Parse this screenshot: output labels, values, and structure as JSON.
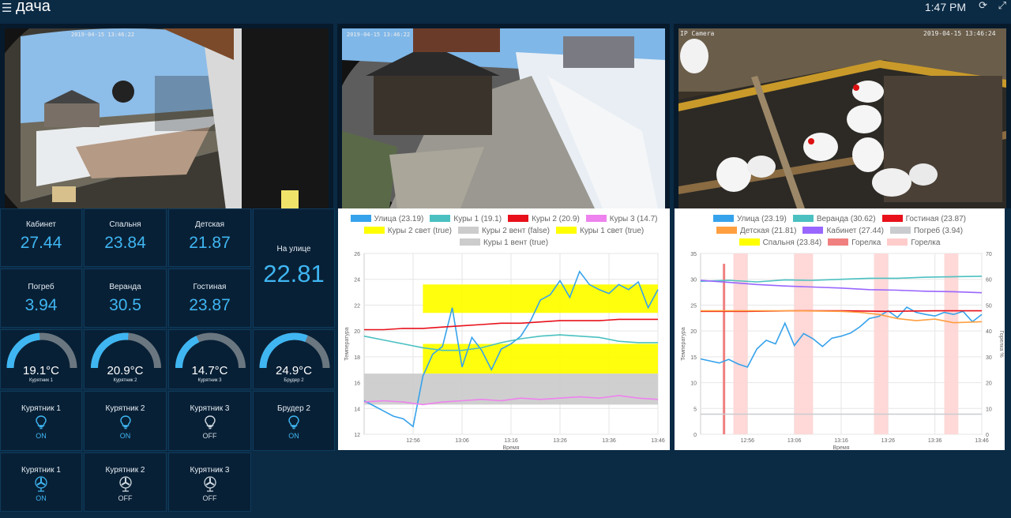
{
  "header": {
    "title": "дача",
    "time": "1:47 PM"
  },
  "cameras": [
    {
      "stamp": "2019-04-15 13:46:22",
      "label": ""
    },
    {
      "stamp": "2019-04-15 13:46:22",
      "label": ""
    },
    {
      "stamp": "2019-04-15 13:46:24",
      "label": "IP Camera"
    }
  ],
  "sensors": [
    {
      "label": "Кабинет",
      "value": "27.44"
    },
    {
      "label": "Спальня",
      "value": "23.84"
    },
    {
      "label": "Детская",
      "value": "21.87"
    },
    {
      "label": "Погреб",
      "value": "3.94"
    },
    {
      "label": "Веранда",
      "value": "30.5"
    },
    {
      "label": "Гостиная",
      "value": "23.87"
    }
  ],
  "outside": {
    "label": "На улице",
    "value": "22.81"
  },
  "gauges": [
    {
      "value": "19.1°C",
      "label": "Курятник 1",
      "level": 19.1,
      "max": 40
    },
    {
      "value": "20.9°C",
      "label": "Курятник 2",
      "level": 20.9,
      "max": 40
    },
    {
      "value": "14.7°C",
      "label": "Курятник 3",
      "level": 14.7,
      "max": 40
    },
    {
      "value": "24.9°C",
      "label": "Брудер 2",
      "level": 24.9,
      "max": 40
    }
  ],
  "lights": [
    {
      "label": "Курятник 1",
      "state": "ON"
    },
    {
      "label": "Курятник 2",
      "state": "ON"
    },
    {
      "label": "Курятник 3",
      "state": "OFF"
    },
    {
      "label": "Брудер 2",
      "state": "ON"
    }
  ],
  "fans": [
    {
      "label": "Курятник 1",
      "state": "ON"
    },
    {
      "label": "Курятник 2",
      "state": "OFF"
    },
    {
      "label": "Курятник 3",
      "state": "OFF"
    }
  ],
  "colors": {
    "accent": "#3fb6f2",
    "bg": "#0b2a44",
    "tile": "#082036"
  },
  "icons": {
    "menu": "menu-icon",
    "refresh": "refresh-icon",
    "fullscreen": "fullscreen-icon",
    "light": "lightbulb-icon",
    "fan": "fan-icon"
  },
  "chart_data": [
    {
      "type": "line",
      "ylabel": "Температура",
      "xlabel": "Время",
      "ylim": [
        12,
        26
      ],
      "yticks": [
        12,
        14,
        16,
        18,
        20,
        22,
        24,
        26
      ],
      "xticks": [
        "12:56",
        "13:06",
        "13:16",
        "13:26",
        "13:36",
        "13:46"
      ],
      "grid": true,
      "legend": [
        {
          "name": "Улица (23.19)",
          "color": "#36a2eb"
        },
        {
          "name": "Куры 1 (19.1)",
          "color": "#4bc0c0"
        },
        {
          "name": "Куры 2 (20.9)",
          "color": "#e8101a"
        },
        {
          "name": "Куры 3 (14.7)",
          "color": "#ee82ee"
        },
        {
          "name": "Куры 2 свет (true)",
          "color": "#ffff00"
        },
        {
          "name": "Куры 2 вент (false)",
          "color": "#cccccc"
        },
        {
          "name": "Куры 1 свет (true)",
          "color": "#ffff00"
        },
        {
          "name": "Куры 1 вент (true)",
          "color": "#cccccc"
        }
      ],
      "bands": [
        {
          "name": "Куры 2 свет (true)",
          "from": "12:58",
          "to": "13:46",
          "ylow": 21.4,
          "yhigh": 23.6,
          "color": "#ffff00"
        },
        {
          "name": "Куры 1 свет (true)",
          "from": "12:58",
          "to": "13:46",
          "ylow": 16.7,
          "yhigh": 19.0,
          "color": "#ffff00"
        },
        {
          "name": "Куры 1 вент (true)",
          "from": "12:46",
          "to": "13:46",
          "ylow": 14.3,
          "yhigh": 16.7,
          "color": "#cccccc"
        }
      ],
      "series": [
        {
          "name": "Улица (23.19)",
          "color": "#36a2eb",
          "x": [
            "12:46",
            "12:48",
            "12:50",
            "12:52",
            "12:54",
            "12:56",
            "12:58",
            "13:00",
            "13:02",
            "13:04",
            "13:06",
            "13:08",
            "13:10",
            "13:12",
            "13:14",
            "13:16",
            "13:18",
            "13:20",
            "13:22",
            "13:24",
            "13:26",
            "13:28",
            "13:30",
            "13:32",
            "13:34",
            "13:36",
            "13:38",
            "13:40",
            "13:42",
            "13:44",
            "13:46"
          ],
          "y": [
            14.6,
            14.2,
            13.8,
            13.4,
            13.2,
            12.6,
            16.5,
            18.2,
            18.8,
            21.8,
            17.2,
            19.5,
            18.5,
            17.0,
            18.6,
            19.0,
            19.6,
            20.8,
            22.4,
            22.8,
            23.9,
            22.6,
            24.6,
            23.6,
            23.2,
            22.9,
            23.6,
            23.2,
            23.8,
            21.8,
            23.2
          ]
        },
        {
          "name": "Куры 1 (19.1)",
          "color": "#4bc0c0",
          "x": [
            "12:46",
            "12:50",
            "12:54",
            "12:58",
            "13:02",
            "13:06",
            "13:10",
            "13:14",
            "13:18",
            "13:22",
            "13:26",
            "13:30",
            "13:34",
            "13:38",
            "13:42",
            "13:46"
          ],
          "y": [
            19.6,
            19.3,
            19.0,
            18.7,
            18.5,
            18.5,
            18.7,
            19.1,
            19.4,
            19.6,
            19.7,
            19.6,
            19.5,
            19.2,
            19.1,
            19.1
          ]
        },
        {
          "name": "Куры 2 (20.9)",
          "color": "#e8101a",
          "x": [
            "12:46",
            "12:50",
            "12:54",
            "12:58",
            "13:02",
            "13:06",
            "13:10",
            "13:14",
            "13:18",
            "13:22",
            "13:26",
            "13:30",
            "13:34",
            "13:38",
            "13:42",
            "13:46"
          ],
          "y": [
            20.1,
            20.1,
            20.2,
            20.2,
            20.3,
            20.4,
            20.5,
            20.6,
            20.6,
            20.7,
            20.8,
            20.8,
            20.8,
            20.9,
            20.9,
            20.9
          ]
        },
        {
          "name": "Куры 3 (14.7)",
          "color": "#ee82ee",
          "x": [
            "12:46",
            "12:50",
            "12:54",
            "12:58",
            "13:02",
            "13:06",
            "13:10",
            "13:14",
            "13:18",
            "13:22",
            "13:26",
            "13:30",
            "13:34",
            "13:38",
            "13:42",
            "13:46"
          ],
          "y": [
            14.5,
            14.6,
            14.5,
            14.3,
            14.5,
            14.6,
            14.7,
            14.6,
            14.8,
            14.7,
            14.8,
            14.9,
            14.8,
            15.0,
            14.8,
            14.7
          ]
        }
      ]
    },
    {
      "type": "line",
      "ylabel": "Температура",
      "ylabel2": "Горелка %",
      "xlabel": "Время",
      "ylim": [
        0,
        35
      ],
      "ylim2": [
        0,
        70
      ],
      "yticks": [
        0,
        5,
        10,
        15,
        20,
        25,
        30,
        35
      ],
      "yticks2": [
        0,
        10,
        20,
        30,
        40,
        50,
        60,
        70
      ],
      "xticks": [
        "12:56",
        "13:06",
        "13:16",
        "13:26",
        "13:36",
        "13:46"
      ],
      "grid": true,
      "legend": [
        {
          "name": "Улица (23.19)",
          "color": "#36a2eb"
        },
        {
          "name": "Веранда (30.62)",
          "color": "#4bc0c0"
        },
        {
          "name": "Гостиная (23.87)",
          "color": "#e8101a"
        },
        {
          "name": "Детская (21.81)",
          "color": "#ff9f40"
        },
        {
          "name": "Кабинет (27.44)",
          "color": "#9966ff"
        },
        {
          "name": "Погреб (3.94)",
          "color": "#c9cbcf"
        },
        {
          "name": "Спальня (23.84)",
          "color": "#ffff00"
        },
        {
          "name": "Горелка",
          "color": "#f08080"
        },
        {
          "name": "Горелка",
          "color": "#ffcccc"
        }
      ],
      "bands": [
        {
          "name": "Горелка",
          "from": "12:53",
          "to": "12:56",
          "color": "#ffd6d6"
        },
        {
          "name": "Горелка",
          "from": "13:06",
          "to": "13:10",
          "color": "#ffd6d6"
        },
        {
          "name": "Горелка",
          "from": "13:23",
          "to": "13:26",
          "color": "#ffd6d6"
        },
        {
          "name": "Горелка",
          "from": "13:38",
          "to": "13:41",
          "color": "#ffd6d6"
        }
      ],
      "spike": {
        "name": "Горелка",
        "at": "12:51",
        "value": 66,
        "color": "#f08080"
      },
      "series": [
        {
          "name": "Улица (23.19)",
          "color": "#36a2eb",
          "x": [
            "12:46",
            "12:48",
            "12:50",
            "12:52",
            "12:54",
            "12:56",
            "12:58",
            "13:00",
            "13:02",
            "13:04",
            "13:06",
            "13:08",
            "13:10",
            "13:12",
            "13:14",
            "13:16",
            "13:18",
            "13:20",
            "13:22",
            "13:24",
            "13:26",
            "13:28",
            "13:30",
            "13:32",
            "13:34",
            "13:36",
            "13:38",
            "13:40",
            "13:42",
            "13:44",
            "13:46"
          ],
          "y": [
            14.6,
            14.2,
            13.8,
            14.5,
            13.6,
            13.0,
            16.5,
            18.2,
            17.5,
            21.5,
            17.2,
            19.5,
            18.5,
            17.0,
            18.6,
            19.0,
            19.6,
            20.8,
            22.4,
            22.8,
            23.9,
            22.6,
            24.6,
            23.6,
            23.2,
            22.9,
            23.6,
            23.2,
            23.8,
            21.8,
            23.2
          ]
        },
        {
          "name": "Веранда (30.62)",
          "color": "#4bc0c0",
          "x": [
            "12:46",
            "12:52",
            "12:58",
            "13:04",
            "13:10",
            "13:16",
            "13:22",
            "13:28",
            "13:34",
            "13:40",
            "13:46"
          ],
          "y": [
            29.6,
            29.8,
            29.5,
            29.9,
            29.8,
            30.0,
            30.2,
            30.2,
            30.4,
            30.5,
            30.6
          ]
        },
        {
          "name": "Кабинет (27.44)",
          "color": "#9966ff",
          "x": [
            "12:46",
            "12:52",
            "12:58",
            "13:04",
            "13:10",
            "13:16",
            "13:22",
            "13:28",
            "13:34",
            "13:40",
            "13:46"
          ],
          "y": [
            29.8,
            29.4,
            29.0,
            28.7,
            28.5,
            28.3,
            28.0,
            27.9,
            27.7,
            27.6,
            27.4
          ]
        },
        {
          "name": "Гостиная (23.87)",
          "color": "#e8101a",
          "x": [
            "12:46",
            "12:56",
            "13:06",
            "13:16",
            "13:26",
            "13:36",
            "13:46"
          ],
          "y": [
            23.8,
            23.8,
            23.9,
            23.9,
            23.8,
            23.9,
            23.9
          ]
        },
        {
          "name": "Детская (21.81)",
          "color": "#ff9f40",
          "x": [
            "12:46",
            "12:56",
            "13:06",
            "13:16",
            "13:20",
            "13:24",
            "13:28",
            "13:32",
            "13:36",
            "13:40",
            "13:46"
          ],
          "y": [
            23.9,
            23.9,
            23.9,
            23.8,
            23.6,
            23.2,
            22.4,
            22.0,
            22.3,
            21.6,
            21.8
          ]
        },
        {
          "name": "Погреб (3.94)",
          "color": "#c9cbcf",
          "x": [
            "12:46",
            "13:46"
          ],
          "y": [
            3.9,
            3.9
          ]
        }
      ]
    }
  ]
}
